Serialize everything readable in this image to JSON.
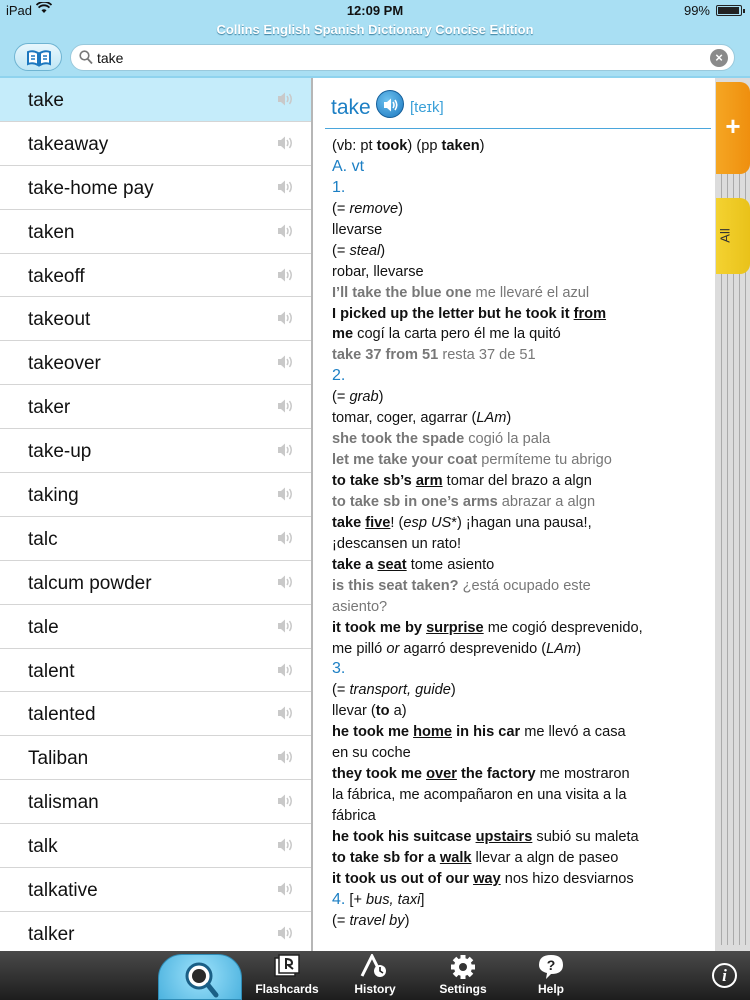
{
  "status": {
    "device": "iPad",
    "time": "12:09 PM",
    "battery": "99%"
  },
  "app": {
    "title": "Collins English Spanish Dictionary Concise Edition"
  },
  "search": {
    "value": "take"
  },
  "wordlist": [
    "take",
    "takeaway",
    "take-home pay",
    "taken",
    "takeoff",
    "takeout",
    "takeover",
    "taker",
    "take-up",
    "taking",
    "talc",
    "talcum powder",
    "tale",
    "talent",
    "talented",
    "Taliban",
    "talisman",
    "talk",
    "talkative",
    "talker"
  ],
  "entry": {
    "headword": "take",
    "phonetic": "[teɪk]",
    "lines": [
      [
        {
          "t": "(vb: pt "
        },
        {
          "t": "took",
          "c": "b"
        },
        {
          "t": ") (pp "
        },
        {
          "t": "taken",
          "c": "b"
        },
        {
          "t": ")"
        }
      ],
      [
        {
          "t": "A.  vt",
          "c": "blue"
        }
      ],
      [
        {
          "t": "1.",
          "c": "blue"
        }
      ],
      [
        {
          "t": "(= "
        },
        {
          "t": "remove",
          "c": "i"
        },
        {
          "t": ")"
        }
      ],
      [
        {
          "t": "llevarse"
        }
      ],
      [
        {
          "t": "(= "
        },
        {
          "t": "steal",
          "c": "i"
        },
        {
          "t": ")"
        }
      ],
      [
        {
          "t": "robar, llevarse"
        }
      ],
      [
        {
          "t": "I’ll take the blue one",
          "c": "ex b"
        },
        {
          "t": " me llevaré el azul",
          "c": "ex"
        }
      ],
      [
        {
          "t": "I picked up the letter but he took it ",
          "c": "b"
        },
        {
          "t": "from",
          "c": "b u"
        }
      ],
      [
        {
          "t": "me",
          "c": "b"
        },
        {
          "t": " cogí la carta pero él me la quitó"
        }
      ],
      [
        {
          "t": "take 37 from 51",
          "c": "ex b"
        },
        {
          "t": " resta 37 de 51",
          "c": "ex"
        }
      ],
      [
        {
          "t": "2.",
          "c": "blue"
        }
      ],
      [
        {
          "t": "(= "
        },
        {
          "t": "grab",
          "c": "i"
        },
        {
          "t": ")"
        }
      ],
      [
        {
          "t": "tomar, coger, agarrar ("
        },
        {
          "t": "LAm",
          "c": "i"
        },
        {
          "t": ")"
        }
      ],
      [
        {
          "t": "she took the spade",
          "c": "ex b"
        },
        {
          "t": " cogió la pala",
          "c": "ex"
        }
      ],
      [
        {
          "t": "let me take your coat",
          "c": "ex b"
        },
        {
          "t": " permíteme tu abrigo",
          "c": "ex"
        }
      ],
      [
        {
          "t": "to take sb’s ",
          "c": "b"
        },
        {
          "t": "arm",
          "c": "b u"
        },
        {
          "t": " tomar del brazo a algn"
        }
      ],
      [
        {
          "t": "to take sb in one’s arms",
          "c": "ex b"
        },
        {
          "t": " abrazar a algn",
          "c": "ex"
        }
      ],
      [
        {
          "t": "take ",
          "c": "b"
        },
        {
          "t": "five",
          "c": "b u"
        },
        {
          "t": "! ("
        },
        {
          "t": "esp US",
          "c": "i"
        },
        {
          "t": "*) ¡hagan una pausa!,"
        }
      ],
      [
        {
          "t": "¡descansen un rato!"
        }
      ],
      [
        {
          "t": "take a ",
          "c": "b"
        },
        {
          "t": "seat",
          "c": "b u"
        },
        {
          "t": " tome asiento"
        }
      ],
      [
        {
          "t": "is this seat taken?",
          "c": "ex b"
        },
        {
          "t": " ¿está ocupado este",
          "c": "ex"
        }
      ],
      [
        {
          "t": "asiento?",
          "c": "ex"
        }
      ],
      [
        {
          "t": "it took me by ",
          "c": "b"
        },
        {
          "t": "surprise",
          "c": "b u"
        },
        {
          "t": " me cogió desprevenido,"
        }
      ],
      [
        {
          "t": "me pilló "
        },
        {
          "t": "or",
          "c": "i"
        },
        {
          "t": " agarró desprevenido ("
        },
        {
          "t": "LAm",
          "c": "i"
        },
        {
          "t": ")"
        }
      ],
      [
        {
          "t": "3.",
          "c": "blue"
        }
      ],
      [
        {
          "t": "(= "
        },
        {
          "t": "transport, guide",
          "c": "i"
        },
        {
          "t": ")"
        }
      ],
      [
        {
          "t": "llevar ("
        },
        {
          "t": "to",
          "c": "b"
        },
        {
          "t": " a)"
        }
      ],
      [
        {
          "t": "he took me ",
          "c": "b"
        },
        {
          "t": "home",
          "c": "b u"
        },
        {
          "t": " in his car",
          "c": "b"
        },
        {
          "t": " me llevó a casa"
        }
      ],
      [
        {
          "t": "en su coche"
        }
      ],
      [
        {
          "t": "they took me ",
          "c": "b"
        },
        {
          "t": "over",
          "c": "b u"
        },
        {
          "t": " the factory",
          "c": "b"
        },
        {
          "t": " me mostraron"
        }
      ],
      [
        {
          "t": "la fábrica, me acompañaron en una visita a la"
        }
      ],
      [
        {
          "t": "fábrica"
        }
      ],
      [
        {
          "t": "he took his suitcase ",
          "c": "b"
        },
        {
          "t": "upstairs",
          "c": "b u"
        },
        {
          "t": " subió su maleta"
        }
      ],
      [
        {
          "t": "to take sb for a ",
          "c": "b"
        },
        {
          "t": "walk",
          "c": "b u"
        },
        {
          "t": " llevar a algn de paseo"
        }
      ],
      [
        {
          "t": "it took us out of our ",
          "c": "b"
        },
        {
          "t": "way",
          "c": "b u"
        },
        {
          "t": " nos hizo desviarnos"
        }
      ],
      [
        {
          "t": "4.",
          "c": "blue"
        },
        {
          "t": "  [+ "
        },
        {
          "t": "bus, taxi",
          "c": "i"
        },
        {
          "t": "]"
        }
      ],
      [
        {
          "t": "(= "
        },
        {
          "t": "travel by",
          "c": "i"
        },
        {
          "t": ")"
        }
      ]
    ]
  },
  "side_tabs": {
    "add": "+",
    "all": "All"
  },
  "tabbar": {
    "items": [
      {
        "label": "Flashcards",
        "icon": "flashcards-icon"
      },
      {
        "label": "History",
        "icon": "history-icon"
      },
      {
        "label": "Settings",
        "icon": "settings-icon"
      },
      {
        "label": "Help",
        "icon": "help-icon"
      }
    ],
    "info": "i"
  },
  "colors": {
    "accent": "#1c7fc4",
    "header_bg": "#a9dff3",
    "selected_row": "#c5ecfa",
    "add_tab": "#f5a623",
    "all_tab": "#f4d231"
  }
}
